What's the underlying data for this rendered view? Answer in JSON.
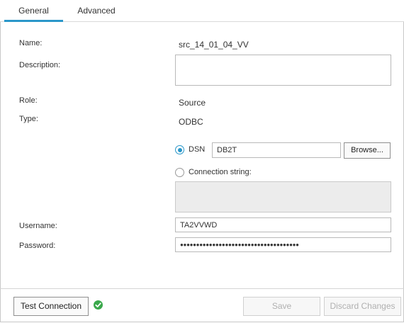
{
  "tabs": [
    {
      "label": "General",
      "active": true
    },
    {
      "label": "Advanced",
      "active": false
    }
  ],
  "form": {
    "name_label": "Name:",
    "name_value": "src_14_01_04_VV",
    "description_label": "Description:",
    "description_value": "",
    "role_label": "Role:",
    "role_value": "Source",
    "type_label": "Type:",
    "type_value": "ODBC",
    "dsn_label": "DSN",
    "dsn_value": "DB2T",
    "dsn_selected": true,
    "browse_label": "Browse...",
    "connection_string_label": "Connection string:",
    "connection_string_value": "",
    "username_label": "Username:",
    "username_value": "TA2VVWD",
    "password_label": "Password:",
    "password_value": "●●●●●●●●●●●●●●●●●●●●●●●●●●●●●●●●●●●●●"
  },
  "footer": {
    "test_connection_label": "Test Connection",
    "test_status": "success",
    "save_label": "Save",
    "discard_label": "Discard Changes"
  },
  "colors": {
    "accent": "#2a97c9",
    "success": "#3aa84b"
  }
}
